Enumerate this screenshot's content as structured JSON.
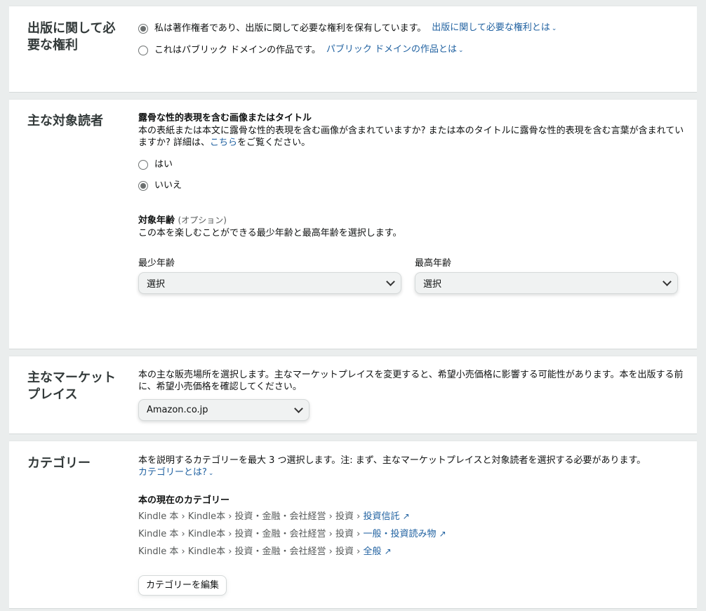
{
  "rights": {
    "title": "出版に関して必要な権利",
    "options": [
      {
        "label": "私は著作権者であり、出版に関して必要な権利を保有しています。",
        "link": "出版に関して必要な権利とは",
        "checked": true
      },
      {
        "label": "これはパブリック ドメインの作品です。",
        "link": "パブリック ドメインの作品とは",
        "checked": false
      }
    ]
  },
  "audience": {
    "title": "主な対象読者",
    "explicit_heading": "露骨な性的表現を含む画像またはタイトル",
    "explicit_desc": "本の表紙または本文に露骨な性的表現を含む画像が含まれていますか? または本のタイトルに露骨な性的表現を含む言葉が含まれていますか? 詳細は、",
    "explicit_link": "こちら",
    "explicit_desc_end": "をご覧ください。",
    "yes": "はい",
    "no": "いいえ",
    "age_heading": "対象年齢",
    "age_optional": "(オプション)",
    "age_desc": "この本を楽しむことができる最少年齢と最高年齢を選択します。",
    "min_label": "最少年齢",
    "max_label": "最高年齢",
    "min_value": "選択",
    "max_value": "選択"
  },
  "marketplace": {
    "title": "主なマーケットプレイス",
    "desc": "本の主な販売場所を選択します。主なマーケットプレイスを変更すると、希望小売価格に影響する可能性があります。本を出版する前に、希望小売価格を確認してください。",
    "value": "Amazon.co.jp"
  },
  "categories": {
    "title": "カテゴリー",
    "desc": "本を説明するカテゴリーを最大 3 つ選択します。注: まず、主なマーケットプレイスと対象読者を選択する必要があります。",
    "help_link": "カテゴリーとは?",
    "current_heading": "本の現在のカテゴリー",
    "paths": [
      {
        "prefix": "Kindle 本 › Kindle本 › 投資・金融・会社経営 › 投資 › ",
        "last": "投資信託"
      },
      {
        "prefix": "Kindle 本 › Kindle本 › 投資・金融・会社経営 › 投資 › ",
        "last": "一般・投資読み物"
      },
      {
        "prefix": "Kindle 本 › Kindle本 › 投資・金融・会社経営 › 投資 › ",
        "last": "全般"
      }
    ],
    "edit_button": "カテゴリーを編集"
  },
  "icons": {
    "chevron": "⌄",
    "external": "↗"
  }
}
